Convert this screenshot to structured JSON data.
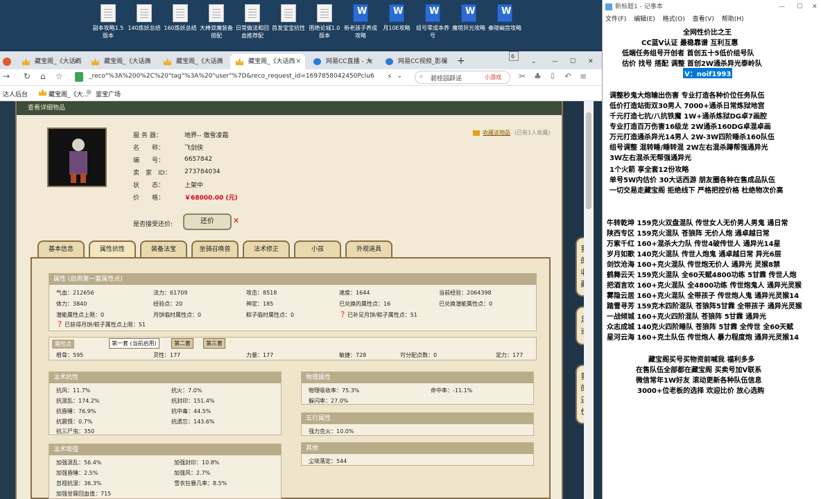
{
  "desktop_icons": [
    "副本攻略1.5版本",
    "140炼妖总结",
    "160炼妖总结",
    "大棒双魔装备搭配",
    "日常做法和回血推荐配",
    "首发宝宝抗性",
    "困绝论城1.0版本",
    "新老孩子养成攻略",
    "月10E攻略",
    "组号零成本养号",
    "魔塔异光攻略",
    "秦陵幽宫攻略"
  ],
  "browser": {
    "tabs": [
      "藏宝阁_《大话西",
      "藏宝阁_《大话西",
      "藏宝阁_《大话西",
      "藏宝阁_《大话西",
      "网易CC直播 - 大",
      "网易CC视频_影视"
    ],
    "tab_count": "6",
    "url": "_reco\"%3A%200%2C%20\"tag\"%3A%20\"user\"%7D&reco_request_id=1697858042450Pclu6",
    "search_placeholder": "碧桂园辟谣",
    "search_hot": "小游戏",
    "bookmarks": [
      "达人后台",
      "藏宝阁_《大...",
      "鉴宝广场"
    ]
  },
  "page": {
    "title": "查看详细物品",
    "favorite_label": "收藏该物品",
    "favorite_count": "(已有1人收藏)",
    "info": [
      {
        "label": "服 务 器：",
        "value": "地界-- 傲雪凌霜"
      },
      {
        "label": "名　　称：",
        "value": "飞剑侠"
      },
      {
        "label": "编　　号：",
        "value": "6657842"
      },
      {
        "label": "卖　家　ID：",
        "value": "273784034"
      },
      {
        "label": "状　　态：",
        "value": "上架中"
      },
      {
        "label": "价　　格：",
        "value": "￥68000.00 (元)"
      }
    ],
    "bargain_label": "是否接受还价:",
    "bargain_button": "还价",
    "tabs": [
      "基本信息",
      "属性抗性",
      "装备法宝",
      "坐骑召唤兽",
      "法术修正",
      "小孩",
      "外观道具"
    ],
    "attr_title": "属性 (启用第一套属性点)",
    "attr_rows": [
      [
        "气血：212656",
        "法力：61709",
        "攻击：8518",
        "速度：1644",
        "当前经验：2064398"
      ],
      [
        "体力：3840",
        "经验点：20",
        "神定：185",
        "已兑换的属性点：16",
        "已兑换潜能属性点：0"
      ],
      [
        "潜能属性点上限：0",
        "月饼临时属性点：0",
        "粽子临时属性点：0",
        "已补足月饼/粽子属性点：51",
        ""
      ]
    ],
    "attr_note": "已获得月饼/粽子属性点上限：51",
    "points_title": "属性点",
    "points_tabs": [
      "第一套 (当前启用)",
      "第二套",
      "第三套"
    ],
    "points_row": [
      "根骨：595",
      "灵性：177",
      "力量：177",
      "敏捷：728",
      "可分配点数：0",
      "定力：177"
    ],
    "resist_title": "法术抗性",
    "resist_rows": [
      [
        "抗风：11.7%",
        "抗火：7.0%"
      ],
      [
        "抗混乱：174.2%",
        "抗封印：151.4%"
      ],
      [
        "抗昏睡：76.9%",
        "抗中毒：44.5%"
      ],
      [
        "抗震慑：0.7%",
        "抗遗忘：143.6%"
      ],
      [
        "抗三尸虫：350",
        ""
      ]
    ],
    "boost_title": "法术增强",
    "boost_rows": [
      [
        "加强混乱：56.4%",
        "加强封印：10.8%"
      ],
      [
        "加强昏睡：2.5%",
        "加强风：2.7%"
      ],
      [
        "忽视抗混：36.3%",
        "雪衣狂暴几率：8.5%"
      ],
      [
        "加强甘霖回血值：715",
        ""
      ]
    ],
    "phys_title": "物理属性",
    "phys_rows": [
      [
        "物理吸收率：75.3%",
        "命中率：-11.1%"
      ],
      [
        "躲闪率：27.0%",
        ""
      ]
    ],
    "wuxing_title": "五行属性",
    "wuxing_rows": [
      "强力克火：10.0%"
    ],
    "other_title": "其他",
    "other_rows": [
      "尘埃落定：544"
    ],
    "side_buttons": [
      "我的收藏",
      "足迹",
      "我的还价"
    ]
  },
  "notepad": {
    "title": "新标题1 - 记事本",
    "menu": [
      "文件(F)",
      "编辑(E)",
      "格式(O)",
      "查看(V)",
      "帮助(H)"
    ],
    "lines": [
      "全网性价比之王",
      "CC蓝V认证 最稳靠谱 互利互惠",
      "低端任务组号开创者    首创五十5低价组号队",
      "估价 找号 搭配 调整     首创2W通杀异光泰岭队",
      "V：noif1993",
      "调整秒鬼大炮输出伤害       专业打造各种价位任务队伍",
      "低价打造站街双30男人          7000+通杀日常炼狱地宫",
      "千元打造七抗/八抗铁魔          1W+通杀炼狱DG卓7画腔",
      "专业打造百万伤害16级龙        2W通杀160DG卓混卓画",
      "万元打造通杀异光14男人        2W-3W四阶睡杀160队伍",
      "组号调整 混转睡/睡转混        2W左右混杀蹲帮强通异光",
      "                                              3W左右混杀无帮强通异光",
      "1个火箭 享全套12份攻略",
      "单号5W内估价 30大话西游        朋友圈各种在售成品队伍",
      "一切交易走藏宝阁 拒绝线下     严格把控价格 杜绝物次价高",
      "牛转乾坤 159克火双盘混队 传世女人无价男人男鬼 通日常",
      "陕西专区 159克火混队 苍狼阵 无价人炮 通卓越日常",
      "万紫千红 160+混杀大力队 传世4破传世人 通异光14星",
      "岁月如歌 140克火混队 传世人炮鬼 通卓越日常 异光6层",
      "剑饮沧海 160+克火混队 传世炮无价人 通异光 灵猴8禁",
      "鹤舞云天 159克火混队 全60天赋4800功练 5甘霖 传世人炮",
      "把酒言欢 160+克火混队 全4800功练 传世炮鬼人 通异光灵猴",
      "雾隐云居 160+克火混队 全带孩子 传世炮人鬼 通异光灵猴14",
      "踏雪寻芳 159克木四阶混队 苍狼阵5甘霖 全带孩子 通异光灵猴",
      "一战倾城 160+克火四阶混队 苍狼阵 5甘霖 通异光",
      "众志成城 140克火四阶睡队 苍狼阵 5甘霖 全传世 全60天赋",
      "星河云海 160+克土队伍 传世炮人 暴力程度炮 通异光灵猴14",
      "藏宝阁买号买物资前喊我 福利多多",
      "在售队伍全部都在藏宝阁 买卖号加V联系",
      "微信常年1W好友 滚动更新各种队伍信息",
      "3000+位老板的选择 欢迎比价 放心选购"
    ]
  }
}
